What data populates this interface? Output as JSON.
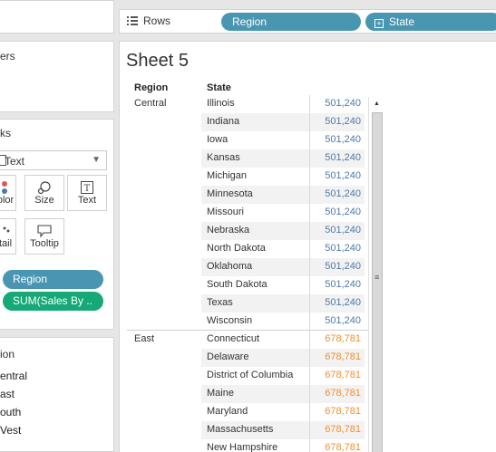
{
  "shelf": {
    "label": "Rows",
    "pills": [
      "Region",
      "State"
    ]
  },
  "left": {
    "filters_title": "ers",
    "marks_title": "ks",
    "mark_type": "Text",
    "buttons": {
      "color": "olor",
      "size": "Size",
      "text": "Text",
      "detail": "tail",
      "tooltip": "Tooltip"
    },
    "mark_pills": [
      "Region",
      "SUM(Sales By .."
    ],
    "legend_title": "ion",
    "legend_items": [
      "entral",
      "ast",
      "outh",
      "Vest"
    ]
  },
  "sheet": {
    "title": "Sheet 5",
    "col_headers": [
      "Region",
      "State"
    ],
    "groups": [
      {
        "region": "Central",
        "value": "501,240",
        "color": "#4e79a7",
        "states": [
          "Illinois",
          "Indiana",
          "Iowa",
          "Kansas",
          "Michigan",
          "Minnesota",
          "Missouri",
          "Nebraska",
          "North Dakota",
          "Oklahoma",
          "South Dakota",
          "Texas",
          "Wisconsin"
        ]
      },
      {
        "region": "East",
        "value": "678,781",
        "color": "#f28e2b",
        "states": [
          "Connecticut",
          "Delaware",
          "District of Columbia",
          "Maine",
          "Maryland",
          "Massachusetts",
          "New Hampshire"
        ]
      }
    ]
  },
  "colors": {
    "region_pill": "#4996b2",
    "measure_pill": "#16a877",
    "central": "#4e79a7",
    "east": "#f28e2b"
  }
}
